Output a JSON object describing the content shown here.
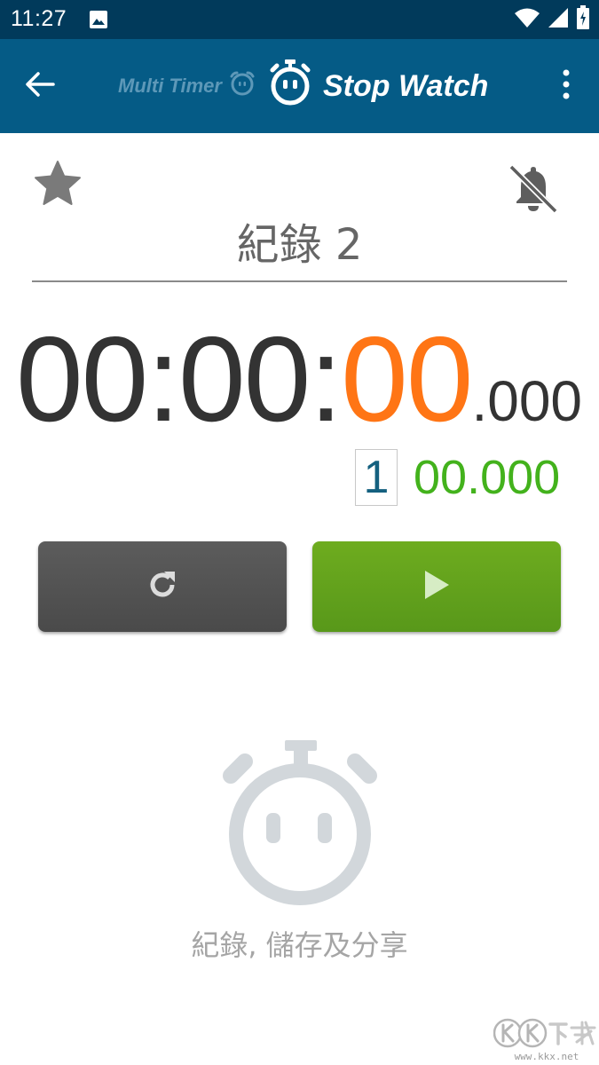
{
  "status_bar": {
    "time": "11:27",
    "icons": [
      "image-notification-icon",
      "wifi-icon",
      "signal-icon",
      "battery-icon"
    ]
  },
  "app_bar": {
    "tab_multi_timer": "Multi Timer",
    "tab_stopwatch": "Stop Watch",
    "icons": [
      "back-arrow-icon",
      "alarm-clock-icon",
      "stopwatch-icon",
      "more-vert-icon"
    ]
  },
  "stopwatch": {
    "record_name": "紀錄 2",
    "hours": "00",
    "minutes": "00",
    "seconds": "00",
    "separator": ":",
    "milliseconds": ".000",
    "lap_count": "1",
    "lap_time": "00.000",
    "icons": [
      "star-icon",
      "bell-off-icon",
      "reset-icon",
      "play-icon"
    ]
  },
  "empty_state": {
    "message": "紀錄, 儲存及分享",
    "icon": "stopwatch-face-icon"
  },
  "watermark": {
    "url": "www.kkx.net"
  },
  "colors": {
    "status_bar": "#013a5b",
    "app_bar": "#055b86",
    "seconds_accent": "#ff7515",
    "lap_time": "#43b21c",
    "lap_count": "#14607f",
    "start_button": "#62a31c",
    "reset_button": "#535353"
  }
}
